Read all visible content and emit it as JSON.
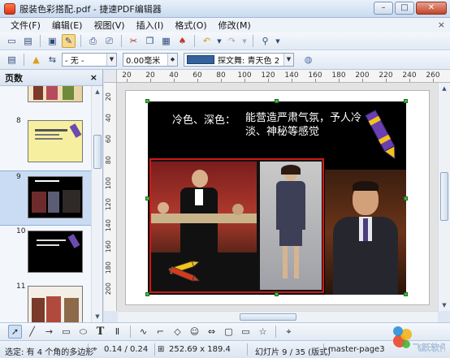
{
  "window": {
    "title": "服装色彩搭配.pdf - 捷速PDF编辑器",
    "buttons": [
      "minimize",
      "maximize",
      "close"
    ]
  },
  "menu": {
    "items": [
      "文件(F)",
      "编辑(E)",
      "视图(V)",
      "插入(I)",
      "格式(O)",
      "修改(M)"
    ],
    "close_glyph": "×"
  },
  "format_toolbar": {
    "line_style": "- 无 -",
    "line_width": "0.00毫米",
    "fill_style": "探文舞: 青天色 2",
    "fill_color": "#35629c"
  },
  "pages_panel": {
    "title": "页数",
    "close_glyph": "×",
    "thumbnails": [
      {
        "number": "8",
        "selected": false
      },
      {
        "number": "9",
        "selected": true
      },
      {
        "number": "10",
        "selected": false
      },
      {
        "number": "11",
        "selected": false
      }
    ]
  },
  "ruler": {
    "horizontal_labels": [
      "20",
      "20",
      "40",
      "60",
      "80",
      "100",
      "120",
      "140",
      "160",
      "180",
      "200",
      "220",
      "240",
      "260"
    ],
    "vertical_labels": [
      "20",
      "40",
      "60",
      "80",
      "100",
      "120",
      "140",
      "160",
      "180",
      "200"
    ]
  },
  "slide": {
    "heading_left": "冷色、深色：",
    "heading_right": "能营造严肃气氛，予人冷淡、神秘等感觉"
  },
  "drawing_toolbar": {
    "text_tool_glyph": "T"
  },
  "status": {
    "selection": "选定: 有 4 个角的多边形",
    "position": "0.14 / 0.24",
    "size": "252.69 x 189.4",
    "slide": "幻灯片 9 / 35 (版式)",
    "master": "master-page3"
  },
  "watermark": {
    "text": "飞跃软件"
  }
}
